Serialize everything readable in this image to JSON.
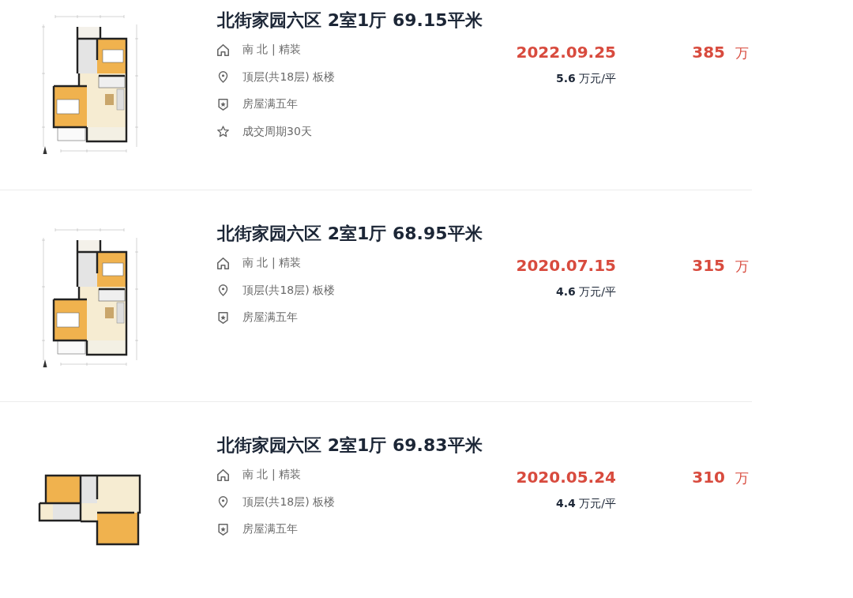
{
  "listings": [
    {
      "title": "北街家园六区 2室1厅 69.15平米",
      "floor_plan": {
        "kind": "portrait"
      },
      "details": [
        {
          "kind": "house",
          "text": "南 北 | 精装"
        },
        {
          "kind": "location",
          "text": "顶层(共18层) 板楼"
        },
        {
          "kind": "shield",
          "text": "房屋满五年"
        },
        {
          "kind": "star",
          "text": "成交周期30天"
        }
      ],
      "deal_date": "2022.09.25",
      "unit_price": "**5.6** 万元/平",
      "price": "385",
      "price_unit": "万"
    },
    {
      "title": "北街家园六区 2室1厅 68.95平米",
      "floor_plan": {
        "kind": "portrait"
      },
      "details": [
        {
          "kind": "house",
          "text": "南 北 | 精装"
        },
        {
          "kind": "location",
          "text": "顶层(共18层) 板楼"
        },
        {
          "kind": "shield",
          "text": "房屋满五年"
        }
      ],
      "deal_date": "2020.07.15",
      "unit_price": "**4.6** 万元/平",
      "price": "315",
      "price_unit": "万"
    },
    {
      "title": "北街家园六区 2室1厅 69.83平米",
      "floor_plan": {
        "kind": "landscape"
      },
      "details": [
        {
          "kind": "house",
          "text": "南 北 | 精装"
        },
        {
          "kind": "location",
          "text": "顶层(共18层) 板楼"
        },
        {
          "kind": "shield",
          "text": "房屋满五年"
        }
      ],
      "deal_date": "2020.05.24",
      "unit_price": "**4.4** 万元/平",
      "price": "310",
      "price_unit": "万"
    }
  ]
}
